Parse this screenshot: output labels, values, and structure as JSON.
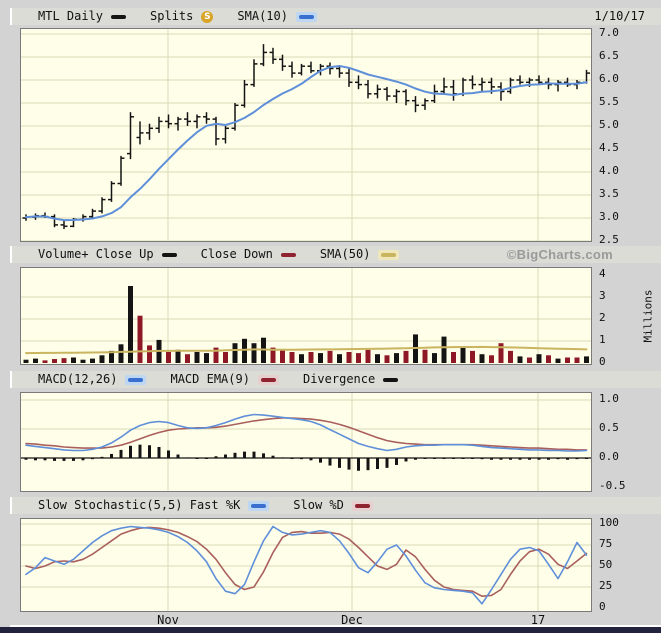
{
  "date_label": "1/10/17",
  "branding": {
    "label": "©BigCharts.com"
  },
  "colors": {
    "page_bg": "#d3d3d3",
    "header_bg": "#dcdcd6",
    "plot_bg": "#ffffe9",
    "grid": "#d9d9b8",
    "frame": "#7a7a7a",
    "black_series": "#141414",
    "blue_line": "#5f8fd9",
    "red_line": "#a9605c",
    "red_bar": "#8f1826",
    "tan_line": "#c9b45f",
    "gold_badge": "#d9a528",
    "brand_gray": "#9a9a9a",
    "bottom_bar": "#23233d"
  },
  "headers": {
    "price": {
      "items": [
        {
          "label": "MTL Daily",
          "swatch": "black"
        },
        {
          "label": "Splits",
          "swatch": "gold-badge",
          "badge_text": "S"
        },
        {
          "label": "SMA(10)",
          "swatch": "blue"
        }
      ]
    },
    "volume": {
      "items": [
        {
          "label": "Volume+ Close Up",
          "swatch": "black"
        },
        {
          "label": "Close Down",
          "swatch": "red"
        },
        {
          "label": "SMA(50)",
          "swatch": "tan"
        }
      ]
    },
    "macd": {
      "items": [
        {
          "label": "MACD(12,26)",
          "swatch": "blue"
        },
        {
          "label": "MACD EMA(9)",
          "swatch": "red"
        },
        {
          "label": "Divergence",
          "swatch": "black"
        }
      ]
    },
    "stoch": {
      "items": [
        {
          "label": "Slow Stochastic(5,5) Fast %K",
          "swatch": "blue"
        },
        {
          "label": "Slow %D",
          "swatch": "red"
        }
      ]
    }
  },
  "xaxis": {
    "labels": [
      {
        "text": "Nov",
        "frac": 0.257
      },
      {
        "text": "Dec",
        "frac": 0.581
      },
      {
        "text": "17",
        "frac": 0.9085
      }
    ]
  },
  "chart_data": [
    {
      "type": "ohlc",
      "title": "MTL Daily with SMA(10) overlay",
      "ylim": [
        2.5,
        7.0
      ],
      "yticks": [
        "7.0",
        "6.5",
        "6.0",
        "5.5",
        "5.0",
        "4.5",
        "4.0",
        "3.5",
        "3.0",
        "2.5"
      ],
      "sma_overlay_window": 10,
      "candles": [
        [
          3.0,
          3.08,
          2.94,
          3.02
        ],
        [
          3.02,
          3.1,
          2.96,
          3.05
        ],
        [
          3.05,
          3.12,
          3.0,
          3.03
        ],
        [
          3.03,
          3.08,
          2.8,
          2.85
        ],
        [
          2.85,
          2.95,
          2.76,
          2.82
        ],
        [
          2.82,
          3.0,
          2.8,
          2.97
        ],
        [
          2.97,
          3.08,
          2.92,
          3.03
        ],
        [
          3.03,
          3.2,
          2.98,
          3.15
        ],
        [
          3.15,
          3.45,
          3.1,
          3.4
        ],
        [
          3.4,
          3.8,
          3.35,
          3.75
        ],
        [
          3.75,
          4.35,
          3.7,
          4.3
        ],
        [
          4.4,
          5.3,
          4.28,
          5.2
        ],
        [
          4.75,
          5.1,
          4.6,
          4.85
        ],
        [
          4.85,
          5.05,
          4.7,
          4.95
        ],
        [
          4.95,
          5.2,
          4.85,
          5.1
        ],
        [
          5.1,
          5.25,
          4.95,
          5.05
        ],
        [
          5.05,
          5.2,
          4.9,
          5.15
        ],
        [
          5.15,
          5.3,
          5.0,
          5.1
        ],
        [
          5.1,
          5.25,
          4.95,
          5.2
        ],
        [
          5.2,
          5.3,
          5.05,
          5.15
        ],
        [
          5.15,
          5.2,
          4.58,
          4.72
        ],
        [
          4.72,
          5.0,
          4.62,
          4.95
        ],
        [
          4.95,
          5.5,
          4.9,
          5.45
        ],
        [
          5.45,
          6.0,
          5.4,
          5.9
        ],
        [
          5.9,
          6.45,
          5.85,
          6.35
        ],
        [
          6.35,
          6.78,
          6.3,
          6.6
        ],
        [
          6.6,
          6.7,
          6.35,
          6.45
        ],
        [
          6.45,
          6.55,
          6.2,
          6.3
        ],
        [
          6.3,
          6.4,
          6.05,
          6.15
        ],
        [
          6.15,
          6.35,
          6.1,
          6.3
        ],
        [
          6.3,
          6.4,
          6.15,
          6.2
        ],
        [
          6.2,
          6.35,
          6.1,
          6.3
        ],
        [
          6.3,
          6.38,
          6.12,
          6.25
        ],
        [
          6.25,
          6.32,
          6.05,
          6.15
        ],
        [
          6.15,
          6.25,
          5.85,
          5.95
        ],
        [
          5.95,
          6.1,
          5.8,
          5.9
        ],
        [
          5.9,
          6.0,
          5.6,
          5.7
        ],
        [
          5.7,
          5.9,
          5.6,
          5.8
        ],
        [
          5.8,
          5.85,
          5.55,
          5.65
        ],
        [
          5.65,
          5.8,
          5.5,
          5.75
        ],
        [
          5.75,
          5.8,
          5.45,
          5.55
        ],
        [
          5.55,
          5.65,
          5.3,
          5.45
        ],
        [
          5.45,
          5.6,
          5.35,
          5.55
        ],
        [
          5.55,
          5.9,
          5.5,
          5.75
        ],
        [
          5.75,
          6.05,
          5.7,
          5.85
        ],
        [
          5.85,
          6.0,
          5.55,
          5.7
        ],
        [
          5.7,
          6.05,
          5.65,
          6.0
        ],
        [
          6.0,
          6.1,
          5.8,
          5.9
        ],
        [
          5.9,
          6.05,
          5.75,
          5.95
        ],
        [
          5.95,
          6.05,
          5.7,
          5.85
        ],
        [
          5.85,
          5.95,
          5.55,
          5.75
        ],
        [
          5.75,
          6.05,
          5.7,
          6.0
        ],
        [
          6.0,
          6.1,
          5.9,
          5.95
        ],
        [
          5.95,
          6.05,
          5.85,
          6.0
        ],
        [
          6.0,
          6.1,
          5.9,
          5.95
        ],
        [
          5.95,
          6.05,
          5.8,
          5.9
        ],
        [
          5.9,
          6.0,
          5.75,
          5.95
        ],
        [
          5.95,
          6.05,
          5.85,
          5.9
        ],
        [
          5.9,
          6.0,
          5.8,
          5.95
        ],
        [
          5.95,
          6.22,
          5.92,
          6.15
        ]
      ]
    },
    {
      "type": "bar",
      "title": "Volume, Close Up vs Close Down, with SMA(50)",
      "ylabel": "Millions",
      "ylim": [
        0,
        4
      ],
      "yticks": [
        4,
        3,
        2,
        1,
        0
      ],
      "bars": [
        [
          0.15,
          "u"
        ],
        [
          0.2,
          "u"
        ],
        [
          0.12,
          "d"
        ],
        [
          0.18,
          "d"
        ],
        [
          0.22,
          "d"
        ],
        [
          0.25,
          "u"
        ],
        [
          0.15,
          "u"
        ],
        [
          0.2,
          "u"
        ],
        [
          0.35,
          "u"
        ],
        [
          0.55,
          "u"
        ],
        [
          0.85,
          "u"
        ],
        [
          3.5,
          "u"
        ],
        [
          2.15,
          "d"
        ],
        [
          0.8,
          "d"
        ],
        [
          1.05,
          "u"
        ],
        [
          0.5,
          "d"
        ],
        [
          0.6,
          "u"
        ],
        [
          0.4,
          "d"
        ],
        [
          0.5,
          "u"
        ],
        [
          0.45,
          "u"
        ],
        [
          0.7,
          "d"
        ],
        [
          0.5,
          "d"
        ],
        [
          0.9,
          "u"
        ],
        [
          1.1,
          "u"
        ],
        [
          0.9,
          "u"
        ],
        [
          1.15,
          "u"
        ],
        [
          0.7,
          "d"
        ],
        [
          0.6,
          "d"
        ],
        [
          0.5,
          "d"
        ],
        [
          0.4,
          "u"
        ],
        [
          0.5,
          "d"
        ],
        [
          0.45,
          "u"
        ],
        [
          0.55,
          "d"
        ],
        [
          0.4,
          "u"
        ],
        [
          0.5,
          "d"
        ],
        [
          0.45,
          "d"
        ],
        [
          0.6,
          "d"
        ],
        [
          0.4,
          "u"
        ],
        [
          0.35,
          "d"
        ],
        [
          0.45,
          "u"
        ],
        [
          0.55,
          "d"
        ],
        [
          1.3,
          "u"
        ],
        [
          0.6,
          "d"
        ],
        [
          0.45,
          "u"
        ],
        [
          1.2,
          "u"
        ],
        [
          0.5,
          "d"
        ],
        [
          0.75,
          "u"
        ],
        [
          0.55,
          "d"
        ],
        [
          0.4,
          "u"
        ],
        [
          0.35,
          "d"
        ],
        [
          0.9,
          "d"
        ],
        [
          0.55,
          "d"
        ],
        [
          0.3,
          "u"
        ],
        [
          0.25,
          "d"
        ],
        [
          0.4,
          "u"
        ],
        [
          0.35,
          "d"
        ],
        [
          0.2,
          "u"
        ],
        [
          0.25,
          "d"
        ],
        [
          0.25,
          "d"
        ],
        [
          0.3,
          "u"
        ]
      ],
      "sma50_points": [
        [
          0,
          0.45
        ],
        [
          8,
          0.48
        ],
        [
          14,
          0.55
        ],
        [
          20,
          0.56
        ],
        [
          24,
          0.62
        ],
        [
          27,
          0.6
        ],
        [
          32,
          0.62
        ],
        [
          36,
          0.64
        ],
        [
          40,
          0.67
        ],
        [
          44,
          0.72
        ],
        [
          48,
          0.73
        ],
        [
          52,
          0.7
        ],
        [
          55,
          0.66
        ],
        [
          59,
          0.62
        ]
      ]
    },
    {
      "type": "line",
      "title": "MACD(12,26) with MACD EMA(9) and Divergence histogram",
      "ylim": [
        -0.5,
        1.0
      ],
      "yticks": [
        "1.0",
        "0.5",
        "0.0",
        "-0.5"
      ],
      "macd": [
        0.22,
        0.2,
        0.18,
        0.16,
        0.14,
        0.13,
        0.13,
        0.15,
        0.19,
        0.26,
        0.36,
        0.48,
        0.56,
        0.61,
        0.63,
        0.61,
        0.56,
        0.52,
        0.51,
        0.52,
        0.56,
        0.61,
        0.67,
        0.72,
        0.75,
        0.74,
        0.72,
        0.7,
        0.68,
        0.66,
        0.63,
        0.57,
        0.49,
        0.41,
        0.33,
        0.25,
        0.2,
        0.16,
        0.13,
        0.15,
        0.19,
        0.21,
        0.22,
        0.22,
        0.23,
        0.23,
        0.23,
        0.22,
        0.2,
        0.18,
        0.17,
        0.16,
        0.15,
        0.14,
        0.14,
        0.13,
        0.13,
        0.12,
        0.12,
        0.13
      ],
      "ema9": [
        0.25,
        0.24,
        0.22,
        0.21,
        0.19,
        0.18,
        0.17,
        0.17,
        0.17,
        0.19,
        0.22,
        0.27,
        0.33,
        0.39,
        0.44,
        0.48,
        0.5,
        0.51,
        0.52,
        0.52,
        0.53,
        0.55,
        0.58,
        0.61,
        0.64,
        0.66,
        0.68,
        0.69,
        0.69,
        0.68,
        0.67,
        0.65,
        0.62,
        0.58,
        0.53,
        0.47,
        0.41,
        0.35,
        0.3,
        0.27,
        0.25,
        0.24,
        0.23,
        0.23,
        0.23,
        0.23,
        0.23,
        0.23,
        0.22,
        0.21,
        0.2,
        0.19,
        0.18,
        0.17,
        0.17,
        0.16,
        0.15,
        0.15,
        0.14,
        0.14
      ],
      "divergence_note": "histogram = macd - ema9"
    },
    {
      "type": "line",
      "title": "Slow Stochastic(5,5): Fast %K and Slow %D",
      "ylim": [
        0,
        100
      ],
      "yticks": [
        100,
        75,
        50,
        25,
        0
      ],
      "fast_k": [
        40,
        48,
        60,
        56,
        52,
        58,
        68,
        78,
        86,
        92,
        95,
        97,
        96,
        95,
        93,
        90,
        85,
        78,
        68,
        55,
        35,
        20,
        17,
        28,
        55,
        80,
        97,
        90,
        87,
        88,
        90,
        92,
        90,
        80,
        65,
        48,
        42,
        55,
        70,
        75,
        62,
        45,
        30,
        24,
        22,
        21,
        20,
        18,
        5,
        22,
        40,
        58,
        70,
        72,
        68,
        52,
        35,
        55,
        78,
        63
      ],
      "slow_d": [
        50,
        47,
        50,
        55,
        56,
        55,
        58,
        64,
        72,
        80,
        88,
        92,
        95,
        96,
        95,
        93,
        90,
        85,
        79,
        70,
        58,
        42,
        28,
        22,
        25,
        43,
        66,
        84,
        90,
        91,
        89,
        89,
        90,
        88,
        82,
        72,
        61,
        50,
        46,
        52,
        69,
        61,
        46,
        33,
        25,
        22,
        21,
        20,
        14,
        15,
        22,
        40,
        56,
        67,
        70,
        64,
        52,
        47,
        56,
        65
      ]
    }
  ]
}
